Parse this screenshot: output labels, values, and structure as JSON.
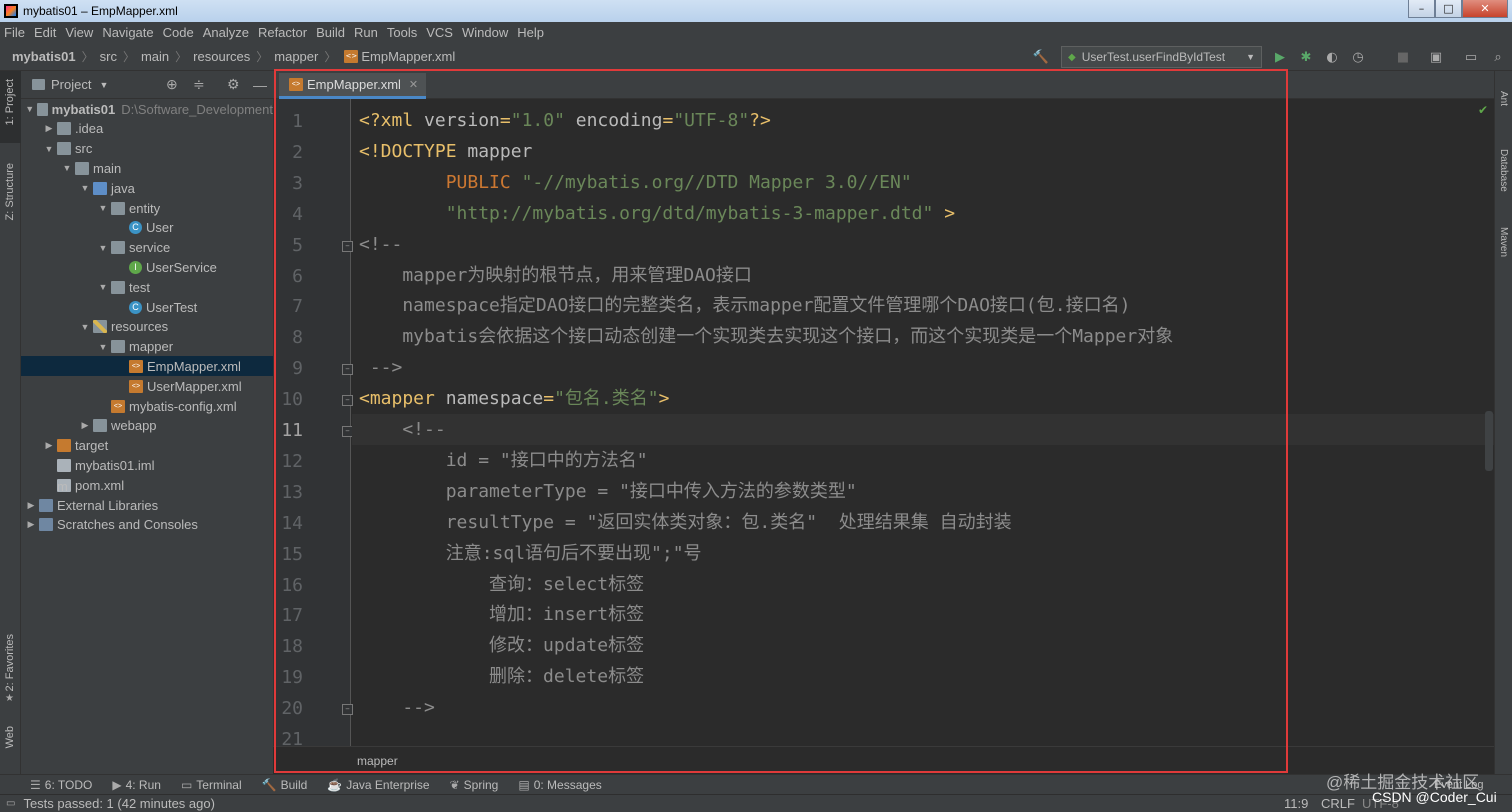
{
  "window": {
    "title": "mybatis01 – EmpMapper.xml"
  },
  "menu": [
    "File",
    "Edit",
    "View",
    "Navigate",
    "Code",
    "Analyze",
    "Refactor",
    "Build",
    "Run",
    "Tools",
    "VCS",
    "Window",
    "Help"
  ],
  "breadcrumb": [
    "mybatis01",
    "src",
    "main",
    "resources",
    "mapper",
    "EmpMapper.xml"
  ],
  "run_config": "UserTest.userFindByIdTest",
  "left_strip": {
    "project": "1: Project",
    "structure": "Z: Structure",
    "favorites": "2: Favorites",
    "web": "Web"
  },
  "right_strip": {
    "ant": "Ant",
    "database": "Database",
    "maven": "Maven"
  },
  "project_panel": {
    "title": "Project",
    "tree": [
      {
        "label": "mybatis01",
        "extra": "D:\\Software_Development",
        "icon": "folder-module",
        "depth": 0,
        "expanded": true,
        "bold": true
      },
      {
        "label": ".idea",
        "icon": "folder",
        "depth": 1,
        "expanded": false
      },
      {
        "label": "src",
        "icon": "folder",
        "depth": 1,
        "expanded": true
      },
      {
        "label": "main",
        "icon": "folder",
        "depth": 2,
        "expanded": true
      },
      {
        "label": "java",
        "icon": "folder-source",
        "depth": 3,
        "expanded": true
      },
      {
        "label": "entity",
        "icon": "package",
        "depth": 4,
        "expanded": true
      },
      {
        "label": "User",
        "icon": "class",
        "depth": 5
      },
      {
        "label": "service",
        "icon": "package",
        "depth": 4,
        "expanded": true
      },
      {
        "label": "UserService",
        "icon": "interface",
        "depth": 5
      },
      {
        "label": "test",
        "icon": "package",
        "depth": 4,
        "expanded": true
      },
      {
        "label": "UserTest",
        "icon": "class",
        "depth": 5
      },
      {
        "label": "resources",
        "icon": "folder-resources",
        "depth": 3,
        "expanded": true
      },
      {
        "label": "mapper",
        "icon": "folder",
        "depth": 4,
        "expanded": true
      },
      {
        "label": "EmpMapper.xml",
        "icon": "xml",
        "depth": 5,
        "selected": true
      },
      {
        "label": "UserMapper.xml",
        "icon": "xml",
        "depth": 5
      },
      {
        "label": "mybatis-config.xml",
        "icon": "xml",
        "depth": 4
      },
      {
        "label": "webapp",
        "icon": "folder-web",
        "depth": 3,
        "expanded": false
      },
      {
        "label": "target",
        "icon": "folder-excluded",
        "depth": 1,
        "expanded": false
      },
      {
        "label": "mybatis01.iml",
        "icon": "file",
        "depth": 1
      },
      {
        "label": "pom.xml",
        "icon": "maven-file",
        "depth": 1
      },
      {
        "label": "External Libraries",
        "icon": "library",
        "depth": 0,
        "expanded": false
      },
      {
        "label": "Scratches and Consoles",
        "icon": "scratches",
        "depth": 0,
        "expanded": false
      }
    ]
  },
  "editor": {
    "tab": "EmpMapper.xml",
    "current_line": 11,
    "lines": [
      [
        [
          "tag",
          "<?xml "
        ],
        [
          "attr",
          "version"
        ],
        [
          "tag",
          "="
        ],
        [
          "val",
          "\"1.0\""
        ],
        [
          "attr",
          " encoding"
        ],
        [
          "tag",
          "="
        ],
        [
          "val",
          "\"UTF-8\""
        ],
        [
          "tag",
          "?>"
        ]
      ],
      [
        [
          "tag",
          "<!DOCTYPE "
        ],
        [
          "attr",
          "mapper"
        ]
      ],
      [
        [
          "pub",
          "        PUBLIC "
        ],
        [
          "val",
          "\"-//mybatis.org//DTD Mapper 3.0//EN\""
        ]
      ],
      [
        [
          "val",
          "        \"http://mybatis.org/dtd/mybatis-3-mapper.dtd\""
        ],
        [
          "tag",
          " >"
        ]
      ],
      [
        [
          "cmt",
          "<!--"
        ]
      ],
      [
        [
          "cmt",
          "    mapper为映射的根节点，用来管理DAO接口"
        ]
      ],
      [
        [
          "cmt",
          "    namespace指定DAO接口的完整类名，表示mapper配置文件管理哪个DAO接口(包.接口名)"
        ]
      ],
      [
        [
          "cmt",
          "    mybatis会依据这个接口动态创建一个实现类去实现这个接口，而这个实现类是一个Mapper对象"
        ]
      ],
      [
        [
          "cmt",
          " -->"
        ]
      ],
      [
        [
          "tag",
          "<mapper "
        ],
        [
          "attr",
          "namespace"
        ],
        [
          "tag",
          "="
        ],
        [
          "val",
          "\"包名.类名\""
        ],
        [
          "tag",
          ">"
        ]
      ],
      [
        [
          "cmt",
          "    <!--"
        ]
      ],
      [
        [
          "cmt",
          "        id = \"接口中的方法名\""
        ]
      ],
      [
        [
          "cmt",
          "        parameterType = \"接口中传入方法的参数类型\""
        ]
      ],
      [
        [
          "cmt",
          "        resultType = \"返回实体类对象：包.类名\"  处理结果集 自动封装"
        ]
      ],
      [
        [
          "cmt",
          "        注意:sql语句后不要出现\";\"号"
        ]
      ],
      [
        [
          "cmt",
          "            查询：select标签"
        ]
      ],
      [
        [
          "cmt",
          "            增加：insert标签"
        ]
      ],
      [
        [
          "cmt",
          "            修改：update标签"
        ]
      ],
      [
        [
          "cmt",
          "            删除：delete标签"
        ]
      ],
      [
        [
          "cmt",
          "    -->"
        ]
      ],
      [
        [
          "cmt",
          ""
        ]
      ]
    ],
    "line_numbers": [
      "1",
      "2",
      "3",
      "4",
      "5",
      "6",
      "7",
      "8",
      "9",
      "10",
      "11",
      "12",
      "13",
      "14",
      "15",
      "16",
      "17",
      "18",
      "19",
      "20",
      "21"
    ],
    "bottom_breadcrumb": "mapper"
  },
  "bottom_tools": [
    "6: TODO",
    "4: Run",
    "Terminal",
    "Build",
    "Java Enterprise",
    "Spring",
    "0: Messages"
  ],
  "status": {
    "message": "Tests passed: 1 (42 minutes ago)",
    "position": "11:9",
    "line_sep": "CRLF",
    "encoding": "UTF-8",
    "event_log": "Event Log"
  },
  "watermarks": {
    "juejin": "@稀土掘金技术社区",
    "csdn": "CSDN @Coder_Cui"
  },
  "colors": {
    "accent": "#4a88c7",
    "highlight_box": "#e03a3a",
    "tag": "#e8bf6a",
    "string": "#6a8759",
    "comment": "#8c8c8c"
  }
}
